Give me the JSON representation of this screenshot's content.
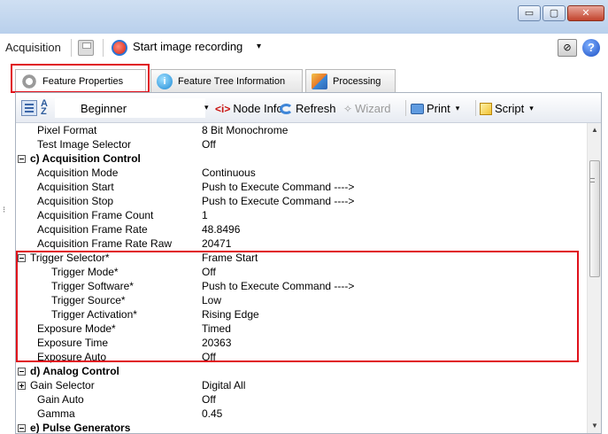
{
  "window": {
    "minimize_glyph": "▭",
    "maximize_glyph": "▢",
    "close_glyph": "✕"
  },
  "toolbar": {
    "acquisition_label": "Acquisition",
    "record_label": "Start image recording",
    "record_caret": "▾",
    "help_glyph": "?",
    "camera_glyph": "⊘"
  },
  "tabs": [
    {
      "label": "Feature Properties",
      "active": true
    },
    {
      "label": "Feature Tree Information",
      "icon_glyph": "i"
    },
    {
      "label": "Processing"
    }
  ],
  "feature_toolbar": {
    "sort_glyph": "A\nZ",
    "visibility_level": "Beginner",
    "node_info_icon": "<i>",
    "node_info": "Node Info",
    "refresh": "Refresh",
    "wizard_icon": "✧",
    "wizard": "Wizard",
    "print": "Print",
    "script": "Script",
    "caret": "▾"
  },
  "rows": [
    {
      "name": "Pixel Format",
      "value": "8 Bit Monochrome"
    },
    {
      "name": "Test Image Selector",
      "value": "Off"
    },
    {
      "category": "c) Acquisition Control"
    },
    {
      "name": "Acquisition Mode",
      "value": "Continuous"
    },
    {
      "name": "Acquisition Start",
      "value": "Push to Execute Command ---->"
    },
    {
      "name": "Acquisition Stop",
      "value": "Push to Execute Command ---->"
    },
    {
      "name": "Acquisition Frame Count",
      "value": "1"
    },
    {
      "name": "Acquisition Frame Rate",
      "value": "48.8496"
    },
    {
      "name": "Acquisition Frame Rate Raw",
      "value": "20471"
    },
    {
      "name": "Trigger Selector*",
      "value": "Frame Start",
      "expanded": true
    },
    {
      "name": "Trigger Mode*",
      "value": "Off",
      "sub": true
    },
    {
      "name": "Trigger Software*",
      "value": "Push to Execute Command ---->",
      "sub": true
    },
    {
      "name": "Trigger Source*",
      "value": "Low",
      "sub": true
    },
    {
      "name": "Trigger Activation*",
      "value": "Rising Edge",
      "sub": true
    },
    {
      "name": "Exposure Mode*",
      "value": "Timed"
    },
    {
      "name": "Exposure Time",
      "value": "20363"
    },
    {
      "name": "Exposure Auto",
      "value": "Off"
    },
    {
      "category": "d) Analog Control"
    },
    {
      "name": "Gain Selector",
      "value": "Digital All",
      "collapsed": true
    },
    {
      "name": "Gain Auto",
      "value": "Off"
    },
    {
      "name": "Gamma",
      "value": "0.45"
    },
    {
      "category": "e) Pulse Generators"
    }
  ],
  "scrollbar": {
    "up_glyph": "▲",
    "down_glyph": "▼",
    "position": 0.16
  }
}
